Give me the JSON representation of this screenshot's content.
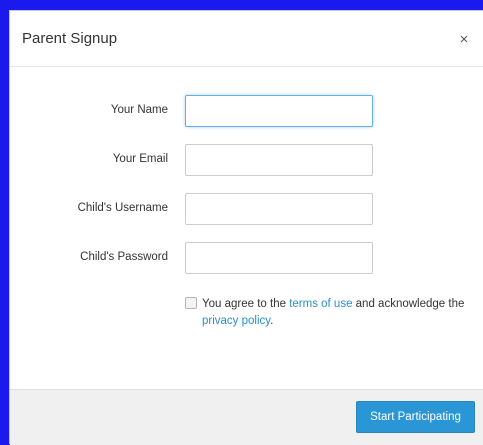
{
  "modal": {
    "title": "Parent Signup",
    "close_glyph": "×",
    "close_icon": "close-icon"
  },
  "form": {
    "fields": [
      {
        "label": "Your Name",
        "value": "",
        "placeholder": "",
        "focused": true
      },
      {
        "label": "Your Email",
        "value": "",
        "placeholder": ""
      },
      {
        "label": "Child's Username",
        "value": "",
        "placeholder": ""
      },
      {
        "label": "Child's Password",
        "value": "",
        "placeholder": ""
      }
    ],
    "agreement": {
      "checked": false,
      "text_before": "You agree to the ",
      "terms_link": "terms of use",
      "text_middle": " and acknowledge the ",
      "privacy_link": "privacy policy",
      "text_after": "."
    }
  },
  "footer": {
    "submit_label": "Start Participating"
  },
  "colors": {
    "backdrop": "#1a1aee",
    "link": "#2a8fc7",
    "primary_button": "#2b96d6",
    "footer_bg": "#f0f0f0"
  }
}
